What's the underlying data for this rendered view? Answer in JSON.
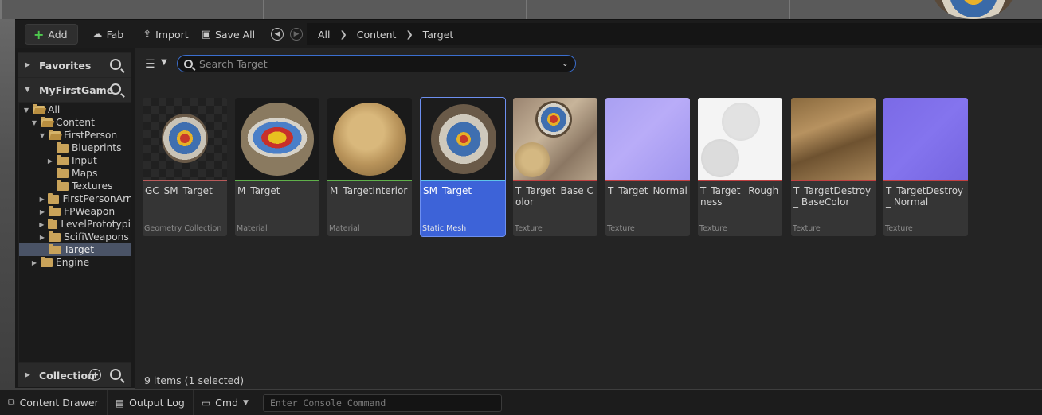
{
  "toolbar": {
    "add_label": "Add",
    "fab_label": "Fab",
    "import_label": "Import",
    "save_all_label": "Save All",
    "breadcrumb": [
      "All",
      "Content",
      "Target"
    ]
  },
  "left_panel": {
    "favorites_label": "Favorites",
    "project_label": "MyFirstGame",
    "collection_label": "Collection",
    "tree": [
      {
        "label": "All",
        "expanded": true
      },
      {
        "label": "Content",
        "expanded": true
      },
      {
        "label": "FirstPerson",
        "expanded": true
      },
      {
        "label": "Blueprints"
      },
      {
        "label": "Input"
      },
      {
        "label": "Maps"
      },
      {
        "label": "Textures"
      },
      {
        "label": "FirstPersonArr"
      },
      {
        "label": "FPWeapon"
      },
      {
        "label": "LevelPrototypi"
      },
      {
        "label": "ScifiWeapons"
      },
      {
        "label": "Target",
        "selected": true
      },
      {
        "label": "Engine"
      }
    ]
  },
  "search": {
    "placeholder": "Search Target",
    "value": ""
  },
  "assets": [
    {
      "name": "GC_SM_Target",
      "type": "Geometry Collection",
      "bar_color": "#b85a5a"
    },
    {
      "name": "M_Target",
      "type": "Material",
      "bar_color": "#5fb04a"
    },
    {
      "name": "M_TargetInterior",
      "type": "Material",
      "bar_color": "#5fb04a"
    },
    {
      "name": "SM_Target",
      "type": "Static Mesh",
      "bar_color": "#5ec3e8",
      "selected": true
    },
    {
      "name": "T_Target_Base Color",
      "type": "Texture",
      "bar_color": "#c04040"
    },
    {
      "name": "T_Target_Normal",
      "type": "Texture",
      "bar_color": "#c04040"
    },
    {
      "name": "T_Target_ Roughness",
      "type": "Texture",
      "bar_color": "#c04040"
    },
    {
      "name": "T_TargetDestroy_ BaseColor",
      "type": "Texture",
      "bar_color": "#c04040"
    },
    {
      "name": "T_TargetDestroy_ Normal",
      "type": "Texture",
      "bar_color": "#c04040"
    }
  ],
  "status": {
    "text": "9 items (1 selected)"
  },
  "bottombar": {
    "content_drawer_label": "Content Drawer",
    "output_log_label": "Output Log",
    "cmd_label": "Cmd",
    "console_placeholder": "Enter Console Command"
  },
  "colors": {
    "selection": "#3d63d8",
    "accent_add": "#4ec94e",
    "search_border": "#3b6fd0"
  }
}
